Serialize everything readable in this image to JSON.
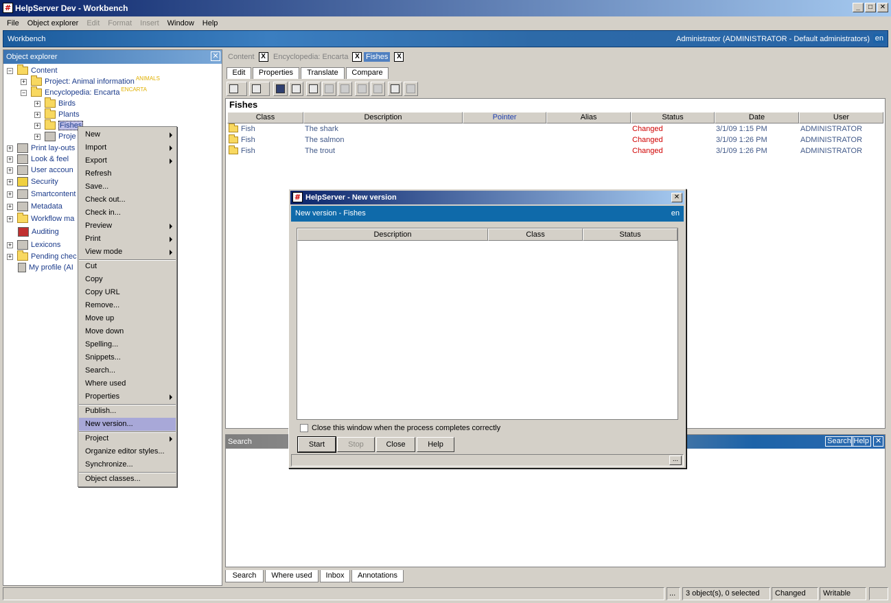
{
  "window": {
    "title": "HelpServer Dev - Workbench"
  },
  "menubar": [
    "File",
    "Object explorer",
    "Edit",
    "Format",
    "Insert",
    "Window",
    "Help"
  ],
  "workbench": {
    "label": "Workbench",
    "user": "Administrator (ADMINISTRATOR - Default administrators)",
    "lang": "en"
  },
  "explorer": {
    "title": "Object explorer",
    "tree": [
      {
        "label": "Content"
      },
      {
        "label": "Project: Animal information",
        "tag": "ANIMALS"
      },
      {
        "label": "Encyclopedia: Encarta",
        "tag": "ENCARTA"
      },
      {
        "label": "Birds"
      },
      {
        "label": "Plants"
      },
      {
        "label": "Fishes"
      },
      {
        "label": "Proje"
      },
      {
        "label": "Print lay-outs"
      },
      {
        "label": "Look & feel"
      },
      {
        "label": "User accoun"
      },
      {
        "label": "Security"
      },
      {
        "label": "Smartcontent"
      },
      {
        "label": "Metadata"
      },
      {
        "label": "Workflow ma"
      },
      {
        "label": "Auditing"
      },
      {
        "label": "Lexicons"
      },
      {
        "label": "Pending chec"
      },
      {
        "label": "My profile (AI"
      }
    ]
  },
  "context_menu": {
    "items": [
      "New",
      "Import",
      "Export",
      "Refresh",
      "Save...",
      "Check out...",
      "Check in...",
      "Preview",
      "Print",
      "View mode",
      "Cut",
      "Copy",
      "Copy URL",
      "Remove...",
      "Move up",
      "Move down",
      "Spelling...",
      "Snippets...",
      "Search...",
      "Where used",
      "Properties",
      "Publish...",
      "New version...",
      "Project",
      "Organize editor styles...",
      "Synchronize...",
      "Object classes..."
    ]
  },
  "doc_tabs": [
    "Content",
    "Encyclopedia: Encarta",
    "Fishes"
  ],
  "doc_tab_close": "X",
  "sub_tabs": [
    "Edit",
    "Properties",
    "Translate",
    "Compare"
  ],
  "content": {
    "heading": "Fishes",
    "columns": [
      "Class",
      "Description",
      "Pointer",
      "Alias",
      "Status",
      "Date",
      "User"
    ],
    "rows": [
      {
        "class": "Fish",
        "description": "The shark",
        "status": "Changed",
        "date": "3/1/09 1:15 PM",
        "user": "ADMINISTRATOR"
      },
      {
        "class": "Fish",
        "description": "The salmon",
        "status": "Changed",
        "date": "3/1/09 1:26 PM",
        "user": "ADMINISTRATOR"
      },
      {
        "class": "Fish",
        "description": "The trout",
        "status": "Changed",
        "date": "3/1/09 1:26 PM",
        "user": "ADMINISTRATOR"
      }
    ]
  },
  "search_panel": {
    "title": "Search",
    "btn_search": "Search",
    "btn_help": "Help"
  },
  "bottom_tabs": [
    "Search",
    "Where used",
    "Inbox",
    "Annotations"
  ],
  "statusbar": {
    "dots": "...",
    "selection": "3 object(s), 0 selected",
    "state": "Changed",
    "mode": "Writable"
  },
  "dialog": {
    "title": "HelpServer - New version",
    "subtitle": "New version - Fishes",
    "lang": "en",
    "columns": [
      "Description",
      "Class",
      "Status"
    ],
    "checkbox_label": "Close this window when the process completes correctly",
    "buttons": {
      "start": "Start",
      "stop": "Stop",
      "close": "Close",
      "help": "Help"
    },
    "dots": "..."
  },
  "colors": {
    "title_gradient_start": "#0a246a",
    "accent_blue": "#0f6aaa",
    "status_changed": "#d00000",
    "tag_yellow": "#e0b000"
  }
}
